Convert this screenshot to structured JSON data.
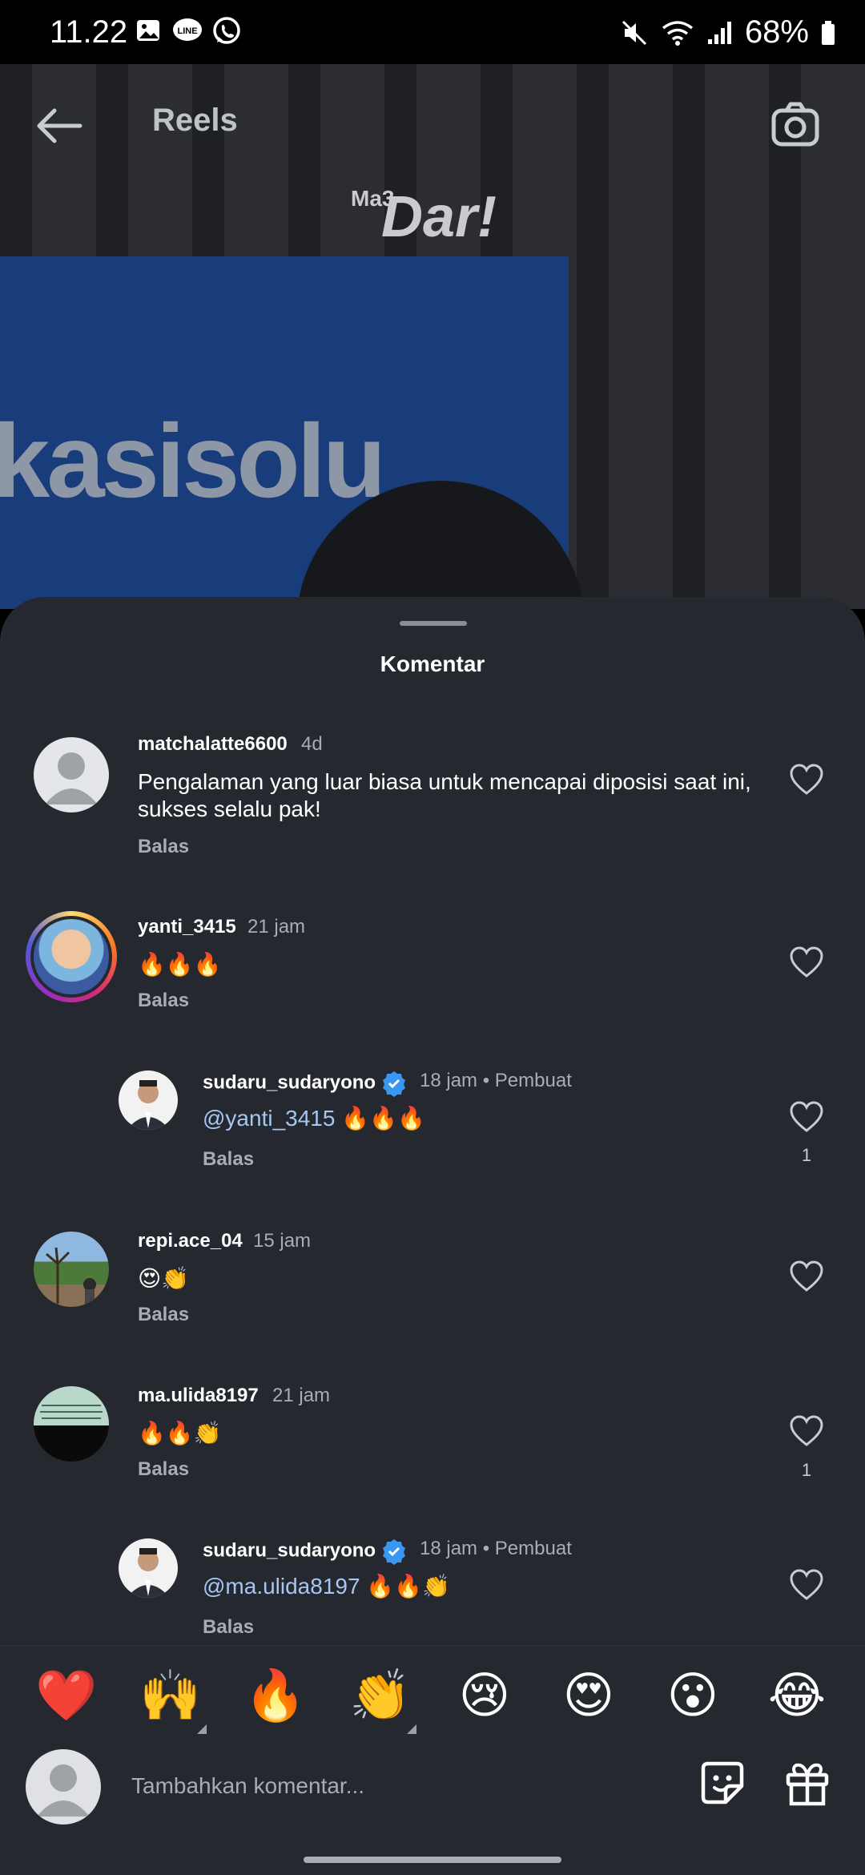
{
  "status_bar": {
    "time": "11.22",
    "battery": "68%"
  },
  "header": {
    "title": "Reels"
  },
  "reel": {
    "logo_small": "Ma3",
    "logo": "Dar!",
    "sign_text": "kasisolu"
  },
  "sheet": {
    "title": "Komentar"
  },
  "comments": [
    {
      "username": "matchalatte6600",
      "time": "4d",
      "text": "Pengalaman yang luar biasa untuk mencapai diposisi saat ini, sukses selalu pak!",
      "reply": "Balas"
    },
    {
      "username": "yanti_3415",
      "time": "21 jam",
      "text": "🔥🔥🔥",
      "reply": "Balas"
    },
    {
      "username": "sudaru_sudaryono",
      "time": "18 jam",
      "creator": "Pembuat",
      "mention": "@yanti_3415",
      "text": " 🔥🔥🔥",
      "reply": "Balas",
      "likes": "1"
    },
    {
      "username": "repi.ace_04",
      "time": "15 jam",
      "text": "😍👏",
      "reply": "Balas"
    },
    {
      "username": "ma.ulida8197",
      "time": "21 jam",
      "text": "🔥🔥👏",
      "reply": "Balas",
      "likes": "1"
    },
    {
      "username": "sudaru_sudaryono",
      "time": "18 jam",
      "creator": "Pembuat",
      "mention": "@ma.ulida8197",
      "text": " 🔥🔥👏",
      "reply": "Balas"
    }
  ],
  "emoji_bar": [
    "❤️",
    "🙌",
    "🔥",
    "👏",
    "😢",
    "😍",
    "😮",
    "😂"
  ],
  "composer": {
    "placeholder": "Tambahkan komentar..."
  },
  "colors": {
    "sheet_bg": "#25292f",
    "mention": "#a6c6f3",
    "verified": "#3897f0",
    "story_ring": "#d62976"
  }
}
